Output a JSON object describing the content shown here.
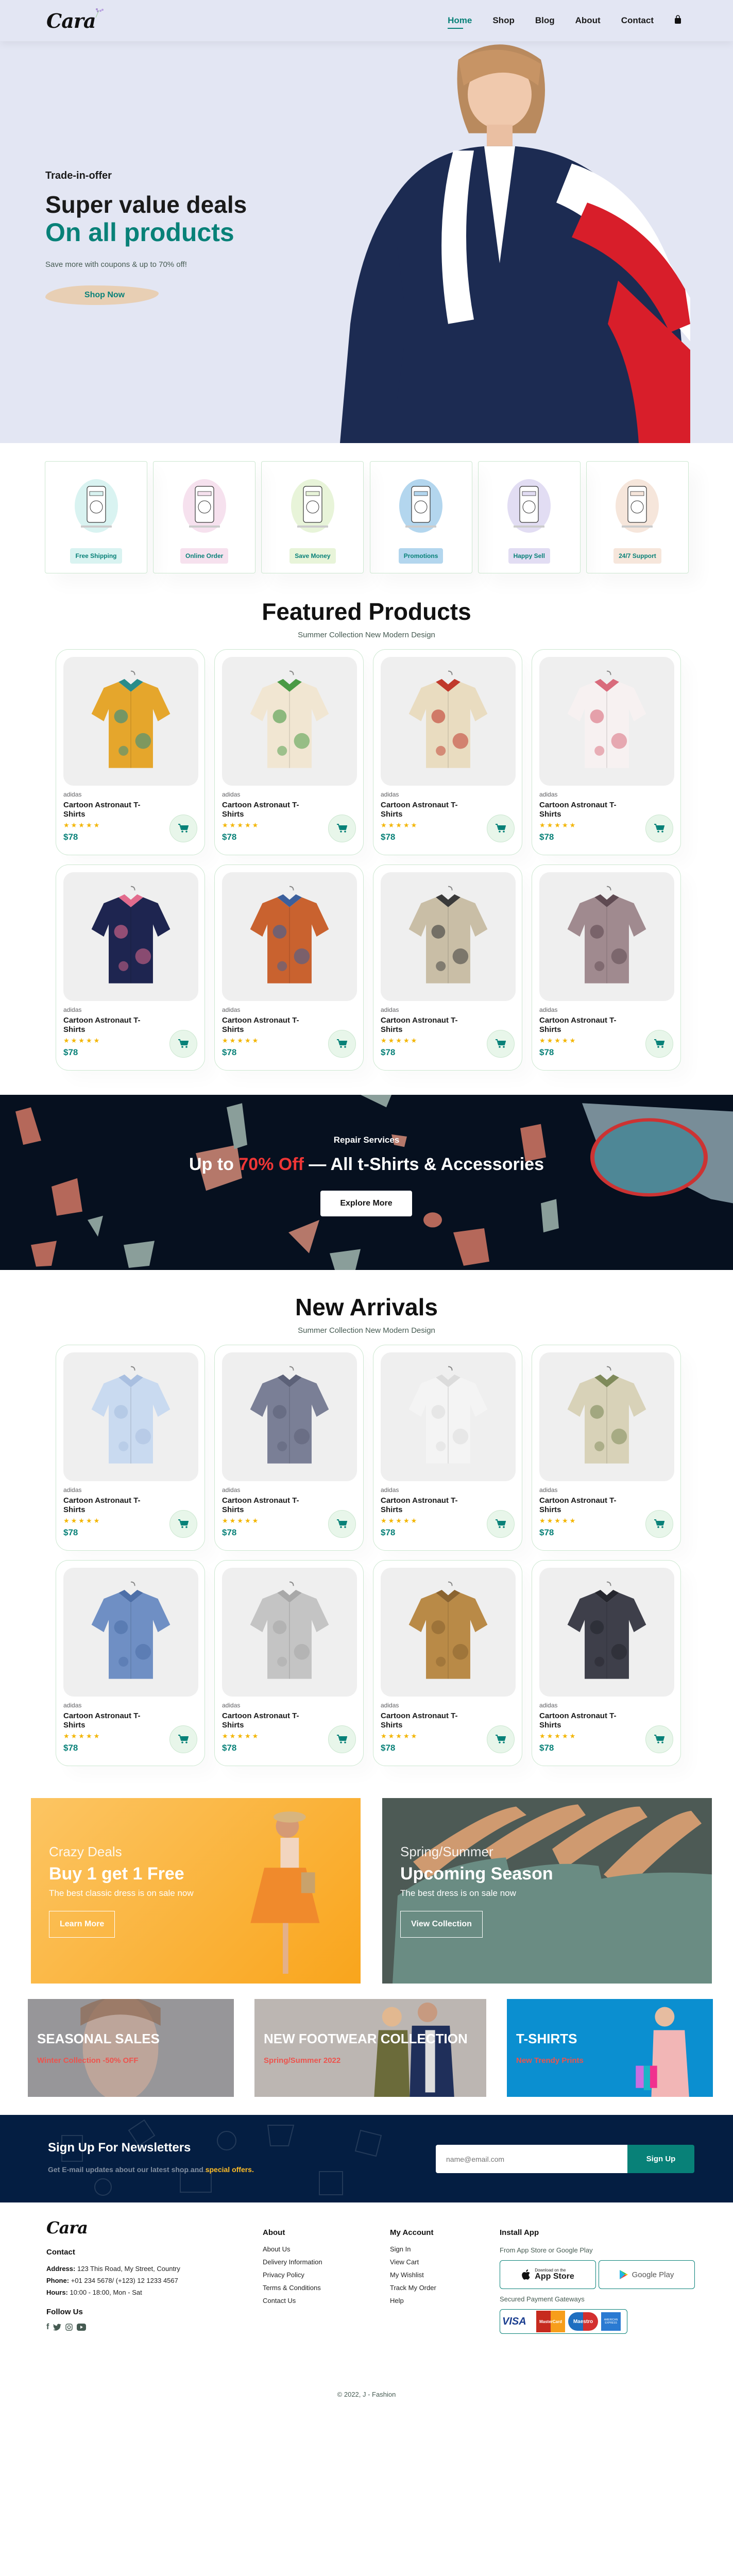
{
  "header": {
    "logo": "Cara",
    "nav": [
      "Home",
      "Shop",
      "Blog",
      "About",
      "Contact"
    ],
    "cart_icon": "shopping-bag-icon"
  },
  "hero": {
    "kicker": "Trade-in-offer",
    "title": "Super value deals",
    "highlight": "On all products",
    "subtitle": "Save more with coupons & up to 70% off!",
    "button": "Shop Now"
  },
  "features": [
    {
      "label": "Free Shipping",
      "bg": "#d9f3f1"
    },
    {
      "label": "Online Order",
      "bg": "#f6e1ee"
    },
    {
      "label": "Save Money",
      "bg": "#e8f4d9"
    },
    {
      "label": "Promotions",
      "bg": "#b3d6ee"
    },
    {
      "label": "Happy Sell",
      "bg": "#e2ddf3"
    },
    {
      "label": "24/7 Support",
      "bg": "#f6e6db"
    }
  ],
  "featured": {
    "title": "Featured Products",
    "subtitle": "Summer Collection New Modern Design",
    "products": [
      {
        "brand": "adidas",
        "name": "Cartoon Astronaut T-Shirts",
        "stars": "★★★★★",
        "price": "$78",
        "c1": "#e5a62c",
        "c2": "#2a8c8a"
      },
      {
        "brand": "adidas",
        "name": "Cartoon Astronaut T-Shirts",
        "stars": "★★★★★",
        "price": "$78",
        "c1": "#f1e6d2",
        "c2": "#4a9a45"
      },
      {
        "brand": "adidas",
        "name": "Cartoon Astronaut T-Shirts",
        "stars": "★★★★★",
        "price": "$78",
        "c1": "#e9dcc0",
        "c2": "#c0392b"
      },
      {
        "brand": "adidas",
        "name": "Cartoon Astronaut T-Shirts",
        "stars": "★★★★★",
        "price": "$78",
        "c1": "#f7f1f1",
        "c2": "#d96b7c"
      },
      {
        "brand": "adidas",
        "name": "Cartoon Astronaut T-Shirts",
        "stars": "★★★★★",
        "price": "$78",
        "c1": "#1e2550",
        "c2": "#e26b8d"
      },
      {
        "brand": "adidas",
        "name": "Cartoon Astronaut T-Shirts",
        "stars": "★★★★★",
        "price": "$78",
        "c1": "#c9622f",
        "c2": "#3b5f9c"
      },
      {
        "brand": "adidas",
        "name": "Cartoon Astronaut T-Shirts",
        "stars": "★★★★★",
        "price": "$78",
        "c1": "#c9bea6",
        "c2": "#3a3a3a"
      },
      {
        "brand": "adidas",
        "name": "Cartoon Astronaut T-Shirts",
        "stars": "★★★★★",
        "price": "$78",
        "c1": "#a08a8f",
        "c2": "#5f4a52"
      }
    ]
  },
  "banner": {
    "kicker": "Repair Services",
    "pre": "Up to ",
    "highlight": "70% Off",
    "post": " — All t-Shirts & Accessories",
    "button": "Explore More"
  },
  "new_arrivals": {
    "title": "New Arrivals",
    "subtitle": "Summer Collection New Modern Design",
    "products": [
      {
        "brand": "adidas",
        "name": "Cartoon Astronaut T-Shirts",
        "stars": "★★★★★",
        "price": "$78",
        "c1": "#c9daf0",
        "c2": "#a9bfe0"
      },
      {
        "brand": "adidas",
        "name": "Cartoon Astronaut T-Shirts",
        "stars": "★★★★★",
        "price": "$78",
        "c1": "#7a7f96",
        "c2": "#5c6178"
      },
      {
        "brand": "adidas",
        "name": "Cartoon Astronaut T-Shirts",
        "stars": "★★★★★",
        "price": "$78",
        "c1": "#f4f4f4",
        "c2": "#dcdcdc"
      },
      {
        "brand": "adidas",
        "name": "Cartoon Astronaut T-Shirts",
        "stars": "★★★★★",
        "price": "$78",
        "c1": "#d8d2b8",
        "c2": "#7f8a5a"
      },
      {
        "brand": "adidas",
        "name": "Cartoon Astronaut T-Shirts",
        "stars": "★★★★★",
        "price": "$78",
        "c1": "#6f8fc4",
        "c2": "#4d6fa8"
      },
      {
        "brand": "adidas",
        "name": "Cartoon Astronaut T-Shirts",
        "stars": "★★★★★",
        "price": "$78",
        "c1": "#c4c4c4",
        "c2": "#a8a8a8"
      },
      {
        "brand": "adidas",
        "name": "Cartoon Astronaut T-Shirts",
        "stars": "★★★★★",
        "price": "$78",
        "c1": "#b98a47",
        "c2": "#8b6430"
      },
      {
        "brand": "adidas",
        "name": "Cartoon Astronaut T-Shirts",
        "stars": "★★★★★",
        "price": "$78",
        "c1": "#3e3f4a",
        "c2": "#25262e"
      }
    ]
  },
  "sm_banners": [
    {
      "kicker": "Crazy Deals",
      "title": "Buy 1 get 1 Free",
      "text": "The best classic dress is on sale now",
      "button": "Learn More"
    },
    {
      "kicker": "Spring/Summer",
      "title": "Upcoming Season",
      "text": "The best dress is on sale now",
      "button": "View Collection"
    }
  ],
  "banner3": [
    {
      "title": "SEASONAL SALES",
      "subtitle": "Winter Collection -50% OFF"
    },
    {
      "title": "NEW FOOTWEAR COLLECTION",
      "subtitle": "Spring/Summer 2022"
    },
    {
      "title": "T-SHIRTS",
      "subtitle": "New Trendy Prints"
    }
  ],
  "newsletter": {
    "title": "Sign Up For Newsletters",
    "text": "Get E-mail updates about our latest shop and ",
    "highlight": "special offers.",
    "placeholder": "name@email.com",
    "button": "Sign Up"
  },
  "footer": {
    "logo": "Cara",
    "contact_title": "Contact",
    "address_label": "Address:",
    "address": "123 This Road, My Street, Country",
    "phone_label": "Phone:",
    "phone": "+01 234 5678/ (+123) 12 1233 4567",
    "hours_label": "Hours:",
    "hours": "10:00 - 18:00, Mon - Sat",
    "follow_title": "Follow Us",
    "about_title": "About",
    "about_links": [
      "About Us",
      "Delivery Information",
      "Privacy Policy",
      "Terms & Conditions",
      "Contact Us"
    ],
    "account_title": "My Account",
    "account_links": [
      "Sign In",
      "View Cart",
      "My Wishlist",
      "Track My Order",
      "Help"
    ],
    "app_title": "Install App",
    "app_text": "From App Store or Google Play",
    "appstore_small": "Download on the",
    "appstore": "App Store",
    "googleplay": "Google Play",
    "payment_text": "Secured Payment Gateways",
    "payments": [
      "VISA",
      "MasterCard",
      "Maestro",
      "AMERICAN EXPRESS"
    ],
    "copyright": "© 2022, J - Fashion"
  }
}
